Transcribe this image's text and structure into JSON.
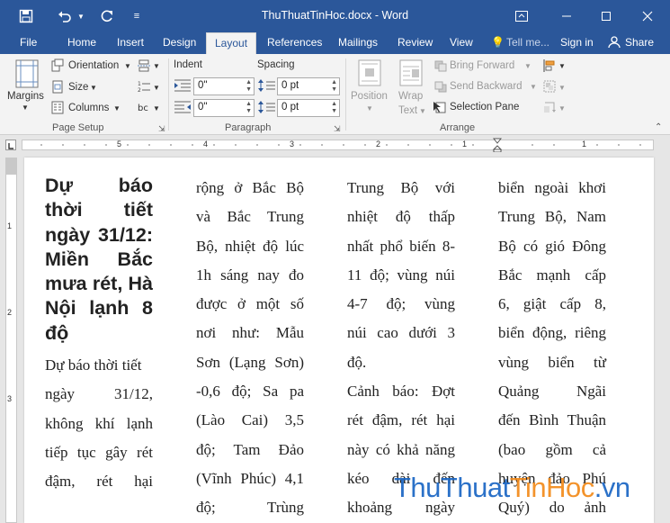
{
  "window": {
    "title": "ThuThuatTinHoc.docx - Word"
  },
  "tabs": [
    {
      "label": "File",
      "active": false
    },
    {
      "label": "Home",
      "active": false
    },
    {
      "label": "Insert",
      "active": false
    },
    {
      "label": "Design",
      "active": false
    },
    {
      "label": "Layout",
      "active": true
    },
    {
      "label": "References",
      "active": false
    },
    {
      "label": "Mailings",
      "active": false
    },
    {
      "label": "Review",
      "active": false
    },
    {
      "label": "View",
      "active": false
    }
  ],
  "tell_me": "Tell me...",
  "sign_in": "Sign in",
  "share": "Share",
  "ribbon": {
    "page_setup": {
      "margins": "Margins",
      "orientation": "Orientation",
      "size": "Size",
      "columns": "Columns",
      "group": "Page Setup"
    },
    "paragraph": {
      "indent_label": "Indent",
      "spacing_label": "Spacing",
      "indent_left": "0\"",
      "indent_right": "0\"",
      "spacing_before": "0 pt",
      "spacing_after": "0 pt",
      "group": "Paragraph"
    },
    "arrange": {
      "position": "Position",
      "wrap": "Wrap",
      "text": "Text",
      "bring_forward": "Bring Forward",
      "send_backward": "Send Backward",
      "selection_pane": "Selection Pane",
      "group": "Arrange"
    }
  },
  "ruler": {
    "marks": [
      "5",
      "4",
      "3",
      "2",
      "1",
      "1"
    ]
  },
  "vruler": {
    "marks": [
      "1",
      "2",
      "3"
    ]
  },
  "document": {
    "heading": "Dự báo thời tiết ngày 31/12: Miền Bắc mưa rét, Hà Nội lạnh 8 độ",
    "col1_lines": [
      "Dự báo thời tiết",
      "ngày 31/12,",
      "không khí lạnh",
      "tiếp tục gây rét",
      "đậm, rét hại"
    ],
    "col2_lines": [
      "rộng ở Bắc Bộ",
      "và Bắc Trung",
      "Bộ, nhiệt độ lúc",
      "1h sáng nay đo",
      "được ở một số",
      "nơi như: Mẫu",
      "Sơn (Lạng Sơn)",
      "-0,6 độ; Sa pa",
      "(Lào Cai) 3,5",
      "độ; Tam Đảo",
      "(Vĩnh Phúc) 4,1",
      "độ; Trùng"
    ],
    "col3_lines": [
      "Trung Bộ với",
      "nhiệt độ thấp",
      "nhất phổ biến 8-",
      "11 độ; vùng núi",
      "4-7 độ; vùng",
      "núi cao dưới 3",
      "độ.",
      "Cảnh báo: Đợt",
      "rét đậm, rét hại",
      "này có khả năng",
      "kéo dài đến",
      "khoảng ngày"
    ],
    "col4_lines": [
      "biển ngoài khơi",
      "Trung Bộ, Nam",
      "Bộ có gió Đông",
      "Bắc mạnh cấp",
      "6, giật cấp 8,",
      "biển động, riêng",
      "vùng biển từ",
      "Quảng Ngãi",
      "đến Bình Thuận",
      "(bao gồm cả",
      "huyện đảo Phú",
      "Quý) do ảnh"
    ]
  },
  "watermark": {
    "part1": "ThuThuat",
    "part2": "TinHoc",
    "part3": ".vn"
  }
}
